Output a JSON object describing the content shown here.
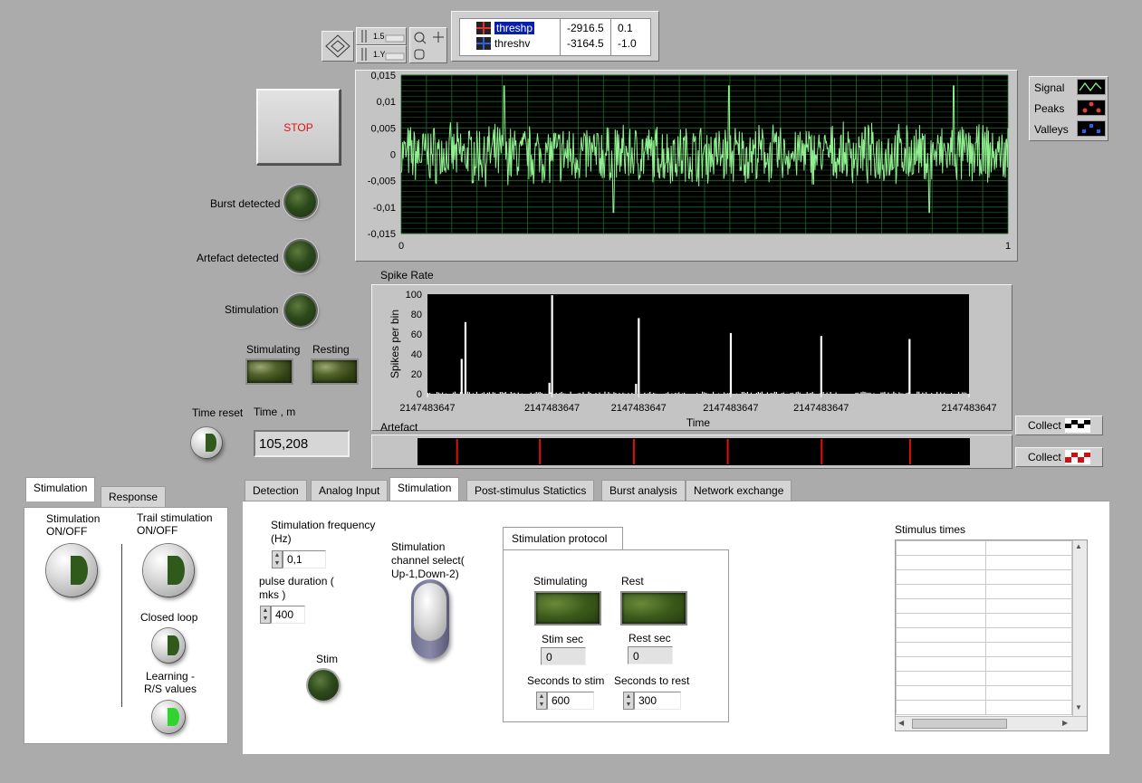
{
  "cursor_legend": {
    "rows": [
      {
        "name": "threshp",
        "value": "-2916.5",
        "y": "0.1"
      },
      {
        "name": "threshv",
        "value": "-3164.5",
        "y": "-1.0"
      }
    ]
  },
  "buttons": {
    "stop": "STOP",
    "collect1": "Collect",
    "collect2": "Collect"
  },
  "indicators": {
    "burst": "Burst detected",
    "artefact": "Artefact detected",
    "stimulation": "Stimulation",
    "stimulating": "Stimulating",
    "resting": "Resting",
    "time_reset": "Time reset",
    "time_label": "Time , m",
    "time_value": "105,208"
  },
  "plot_legend": {
    "signal": "Signal",
    "peaks": "Peaks",
    "valleys": "Valleys"
  },
  "colors": {
    "signal": "#90f090",
    "grid": "#1f6b2b",
    "artefact_marker": "#e01010"
  },
  "chart_data": [
    {
      "type": "line",
      "title": "",
      "series": [
        {
          "name": "Signal",
          "description_hidden": true
        }
      ],
      "x_ticks": [
        "0",
        "1"
      ],
      "xlim": [
        0,
        1
      ],
      "y_ticks": [
        "0,015",
        "0,01",
        "0,005",
        "0",
        "-0,005",
        "-0,01",
        "-0,015"
      ],
      "ylim": [
        -0.015,
        0.015
      ],
      "spikes_x": [
        0.17,
        0.35,
        0.54,
        0.87,
        0.91
      ]
    },
    {
      "type": "bar",
      "title": "Spike Rate",
      "xlabel": "Time",
      "ylabel": "Spikes per bin",
      "y_ticks": [
        "100",
        "80",
        "60",
        "40",
        "20",
        "0"
      ],
      "ylim": [
        0,
        100
      ],
      "x_ticks": [
        "2147483647",
        "2147483647",
        "2147483647",
        "2147483647",
        "2147483647",
        "2147483647"
      ],
      "peaks": [
        {
          "x": 0.07,
          "y": 72
        },
        {
          "x": 0.063,
          "y": 35
        },
        {
          "x": 0.23,
          "y": 99
        },
        {
          "x": 0.225,
          "y": 11
        },
        {
          "x": 0.39,
          "y": 76
        },
        {
          "x": 0.385,
          "y": 10
        },
        {
          "x": 0.56,
          "y": 61
        },
        {
          "x": 0.727,
          "y": 58
        },
        {
          "x": 0.89,
          "y": 55
        }
      ]
    },
    {
      "type": "line",
      "title": "Artefact",
      "markers_x": [
        0.07,
        0.22,
        0.39,
        0.56,
        0.73,
        0.89
      ]
    }
  ],
  "left_tabs": {
    "tabs": [
      "Stimulation",
      "Response"
    ],
    "active": 0
  },
  "left_panel": {
    "stim_onoff": "Stimulation\nON/OFF",
    "trail": "Trail stimulation\nON/OFF",
    "closed_loop": "Closed loop",
    "learning": "Learning -\nR/S values"
  },
  "main_tabs": {
    "tabs": [
      "Detection",
      "Analog Input",
      "Stimulation",
      "Post-stimulus Statictics",
      "Burst analysis",
      "Network exchange"
    ],
    "active": 2
  },
  "stim_tab": {
    "freq_label": "Stimulation frequency\n(Hz)",
    "freq_value": "0,1",
    "pulse_label": "pulse duration (\nmks )",
    "pulse_value": "400",
    "stim_led": "Stim",
    "channel_label": "Stimulation\nchannel select(\nUp-1,Down-2)",
    "protocol_title": "Stimulation protocol",
    "stimulating": "Stimulating",
    "rest": "Rest",
    "stim_sec_label": "Stim sec",
    "stim_sec": "0",
    "rest_sec_label": "Rest sec",
    "rest_sec": "0",
    "secs_to_stim_label": "Seconds to stim",
    "secs_to_stim": "600",
    "secs_to_rest_label": "Seconds to rest",
    "secs_to_rest": "300",
    "stimulus_times": "Stimulus times"
  }
}
